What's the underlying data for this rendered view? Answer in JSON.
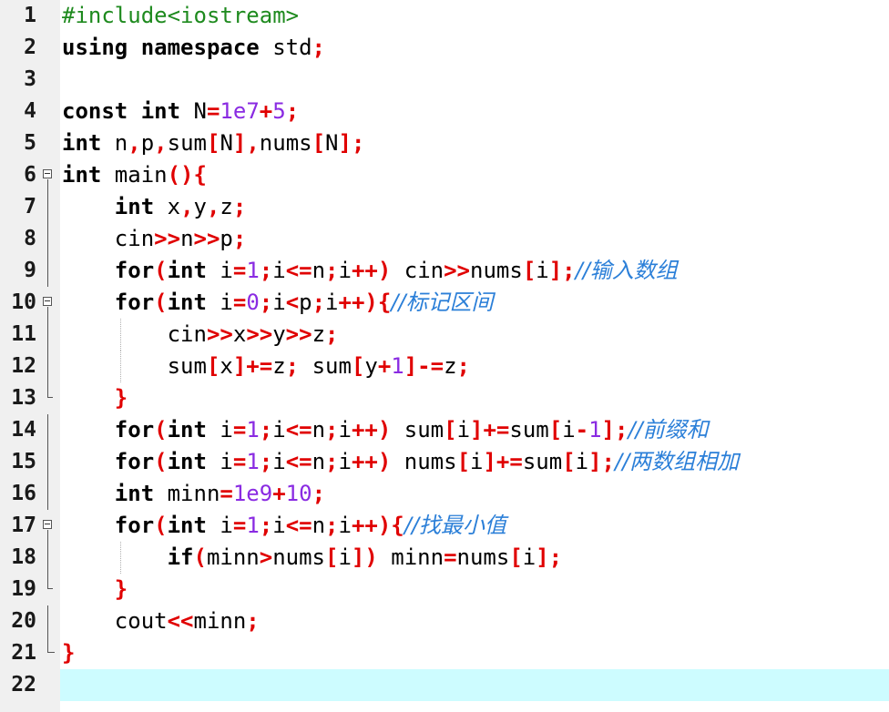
{
  "editor": {
    "current_line": 22,
    "colors": {
      "keyword": "#000000",
      "preprocessor": "#1e8a1e",
      "operator": "#e00000",
      "number": "#8a2be2",
      "comment": "#2b7fd8",
      "current_line_bg": "#cdfcff",
      "gutter_bg": "#f0f0f0"
    },
    "lines": [
      {
        "n": "1",
        "tokens": [
          [
            "pp",
            "#include<iostream>"
          ]
        ]
      },
      {
        "n": "2",
        "tokens": [
          [
            "kw",
            "using"
          ],
          [
            "id",
            " "
          ],
          [
            "kw",
            "namespace"
          ],
          [
            "id",
            " std"
          ],
          [
            "op",
            ";"
          ]
        ]
      },
      {
        "n": "3",
        "tokens": []
      },
      {
        "n": "4",
        "tokens": [
          [
            "kw",
            "const"
          ],
          [
            "id",
            " "
          ],
          [
            "kw",
            "int"
          ],
          [
            "id",
            " N"
          ],
          [
            "op",
            "="
          ],
          [
            "num",
            "1e7"
          ],
          [
            "op",
            "+"
          ],
          [
            "num",
            "5"
          ],
          [
            "op",
            ";"
          ]
        ]
      },
      {
        "n": "5",
        "tokens": [
          [
            "kw",
            "int"
          ],
          [
            "id",
            " n"
          ],
          [
            "op",
            ","
          ],
          [
            "id",
            "p"
          ],
          [
            "op",
            ","
          ],
          [
            "id",
            "sum"
          ],
          [
            "op",
            "["
          ],
          [
            "id",
            "N"
          ],
          [
            "op",
            "]"
          ],
          [
            "op",
            ","
          ],
          [
            "id",
            "nums"
          ],
          [
            "op",
            "["
          ],
          [
            "id",
            "N"
          ],
          [
            "op",
            "]"
          ],
          [
            "op",
            ";"
          ]
        ]
      },
      {
        "n": "6",
        "tokens": [
          [
            "kw",
            "int"
          ],
          [
            "id",
            " main"
          ],
          [
            "op",
            "(){"
          ]
        ]
      },
      {
        "n": "7",
        "tokens": [
          [
            "id",
            "    "
          ],
          [
            "kw",
            "int"
          ],
          [
            "id",
            " x"
          ],
          [
            "op",
            ","
          ],
          [
            "id",
            "y"
          ],
          [
            "op",
            ","
          ],
          [
            "id",
            "z"
          ],
          [
            "op",
            ";"
          ]
        ]
      },
      {
        "n": "8",
        "tokens": [
          [
            "id",
            "    cin"
          ],
          [
            "op",
            ">>"
          ],
          [
            "id",
            "n"
          ],
          [
            "op",
            ">>"
          ],
          [
            "id",
            "p"
          ],
          [
            "op",
            ";"
          ]
        ]
      },
      {
        "n": "9",
        "tokens": [
          [
            "id",
            "    "
          ],
          [
            "kw",
            "for"
          ],
          [
            "op",
            "("
          ],
          [
            "kw",
            "int"
          ],
          [
            "id",
            " i"
          ],
          [
            "op",
            "="
          ],
          [
            "num",
            "1"
          ],
          [
            "op",
            ";"
          ],
          [
            "id",
            "i"
          ],
          [
            "op",
            "<="
          ],
          [
            "id",
            "n"
          ],
          [
            "op",
            ";"
          ],
          [
            "id",
            "i"
          ],
          [
            "op",
            "++)"
          ],
          [
            "id",
            " cin"
          ],
          [
            "op",
            ">>"
          ],
          [
            "id",
            "nums"
          ],
          [
            "op",
            "["
          ],
          [
            "id",
            "i"
          ],
          [
            "op",
            "];"
          ],
          [
            "cm",
            "//输入数组"
          ]
        ]
      },
      {
        "n": "10",
        "tokens": [
          [
            "id",
            "    "
          ],
          [
            "kw",
            "for"
          ],
          [
            "op",
            "("
          ],
          [
            "kw",
            "int"
          ],
          [
            "id",
            " i"
          ],
          [
            "op",
            "="
          ],
          [
            "num",
            "0"
          ],
          [
            "op",
            ";"
          ],
          [
            "id",
            "i"
          ],
          [
            "op",
            "<"
          ],
          [
            "id",
            "p"
          ],
          [
            "op",
            ";"
          ],
          [
            "id",
            "i"
          ],
          [
            "op",
            "++){"
          ],
          [
            "cm",
            "//标记区间"
          ]
        ]
      },
      {
        "n": "11",
        "tokens": [
          [
            "id",
            "        cin"
          ],
          [
            "op",
            ">>"
          ],
          [
            "id",
            "x"
          ],
          [
            "op",
            ">>"
          ],
          [
            "id",
            "y"
          ],
          [
            "op",
            ">>"
          ],
          [
            "id",
            "z"
          ],
          [
            "op",
            ";"
          ]
        ]
      },
      {
        "n": "12",
        "tokens": [
          [
            "id",
            "        sum"
          ],
          [
            "op",
            "["
          ],
          [
            "id",
            "x"
          ],
          [
            "op",
            "]+="
          ],
          [
            "id",
            "z"
          ],
          [
            "op",
            ";"
          ],
          [
            "id",
            " sum"
          ],
          [
            "op",
            "["
          ],
          [
            "id",
            "y"
          ],
          [
            "op",
            "+"
          ],
          [
            "num",
            "1"
          ],
          [
            "op",
            "]-="
          ],
          [
            "id",
            "z"
          ],
          [
            "op",
            ";"
          ]
        ]
      },
      {
        "n": "13",
        "tokens": [
          [
            "id",
            "    "
          ],
          [
            "op",
            "}"
          ]
        ]
      },
      {
        "n": "14",
        "tokens": [
          [
            "id",
            "    "
          ],
          [
            "kw",
            "for"
          ],
          [
            "op",
            "("
          ],
          [
            "kw",
            "int"
          ],
          [
            "id",
            " i"
          ],
          [
            "op",
            "="
          ],
          [
            "num",
            "1"
          ],
          [
            "op",
            ";"
          ],
          [
            "id",
            "i"
          ],
          [
            "op",
            "<="
          ],
          [
            "id",
            "n"
          ],
          [
            "op",
            ";"
          ],
          [
            "id",
            "i"
          ],
          [
            "op",
            "++)"
          ],
          [
            "id",
            " sum"
          ],
          [
            "op",
            "["
          ],
          [
            "id",
            "i"
          ],
          [
            "op",
            "]+="
          ],
          [
            "id",
            "sum"
          ],
          [
            "op",
            "["
          ],
          [
            "id",
            "i"
          ],
          [
            "op",
            "-"
          ],
          [
            "num",
            "1"
          ],
          [
            "op",
            "];"
          ],
          [
            "cm",
            "//前缀和"
          ]
        ]
      },
      {
        "n": "15",
        "tokens": [
          [
            "id",
            "    "
          ],
          [
            "kw",
            "for"
          ],
          [
            "op",
            "("
          ],
          [
            "kw",
            "int"
          ],
          [
            "id",
            " i"
          ],
          [
            "op",
            "="
          ],
          [
            "num",
            "1"
          ],
          [
            "op",
            ";"
          ],
          [
            "id",
            "i"
          ],
          [
            "op",
            "<="
          ],
          [
            "id",
            "n"
          ],
          [
            "op",
            ";"
          ],
          [
            "id",
            "i"
          ],
          [
            "op",
            "++)"
          ],
          [
            "id",
            " nums"
          ],
          [
            "op",
            "["
          ],
          [
            "id",
            "i"
          ],
          [
            "op",
            "]+="
          ],
          [
            "id",
            "sum"
          ],
          [
            "op",
            "["
          ],
          [
            "id",
            "i"
          ],
          [
            "op",
            "];"
          ],
          [
            "cm",
            "//两数组相加"
          ]
        ]
      },
      {
        "n": "16",
        "tokens": [
          [
            "id",
            "    "
          ],
          [
            "kw",
            "int"
          ],
          [
            "id",
            " minn"
          ],
          [
            "op",
            "="
          ],
          [
            "num",
            "1e9"
          ],
          [
            "op",
            "+"
          ],
          [
            "num",
            "10"
          ],
          [
            "op",
            ";"
          ]
        ]
      },
      {
        "n": "17",
        "tokens": [
          [
            "id",
            "    "
          ],
          [
            "kw",
            "for"
          ],
          [
            "op",
            "("
          ],
          [
            "kw",
            "int"
          ],
          [
            "id",
            " i"
          ],
          [
            "op",
            "="
          ],
          [
            "num",
            "1"
          ],
          [
            "op",
            ";"
          ],
          [
            "id",
            "i"
          ],
          [
            "op",
            "<="
          ],
          [
            "id",
            "n"
          ],
          [
            "op",
            ";"
          ],
          [
            "id",
            "i"
          ],
          [
            "op",
            "++){"
          ],
          [
            "cm",
            "//找最小值"
          ]
        ]
      },
      {
        "n": "18",
        "tokens": [
          [
            "id",
            "        "
          ],
          [
            "kw",
            "if"
          ],
          [
            "op",
            "("
          ],
          [
            "id",
            "minn"
          ],
          [
            "op",
            ">"
          ],
          [
            "id",
            "nums"
          ],
          [
            "op",
            "["
          ],
          [
            "id",
            "i"
          ],
          [
            "op",
            "])"
          ],
          [
            "id",
            " minn"
          ],
          [
            "op",
            "="
          ],
          [
            "id",
            "nums"
          ],
          [
            "op",
            "["
          ],
          [
            "id",
            "i"
          ],
          [
            "op",
            "];"
          ]
        ]
      },
      {
        "n": "19",
        "tokens": [
          [
            "id",
            "    "
          ],
          [
            "op",
            "}"
          ]
        ]
      },
      {
        "n": "20",
        "tokens": [
          [
            "id",
            "    cout"
          ],
          [
            "op",
            "<<"
          ],
          [
            "id",
            "minn"
          ],
          [
            "op",
            ";"
          ]
        ]
      },
      {
        "n": "21",
        "tokens": [
          [
            "op",
            "}"
          ]
        ]
      },
      {
        "n": "22",
        "tokens": []
      }
    ]
  }
}
